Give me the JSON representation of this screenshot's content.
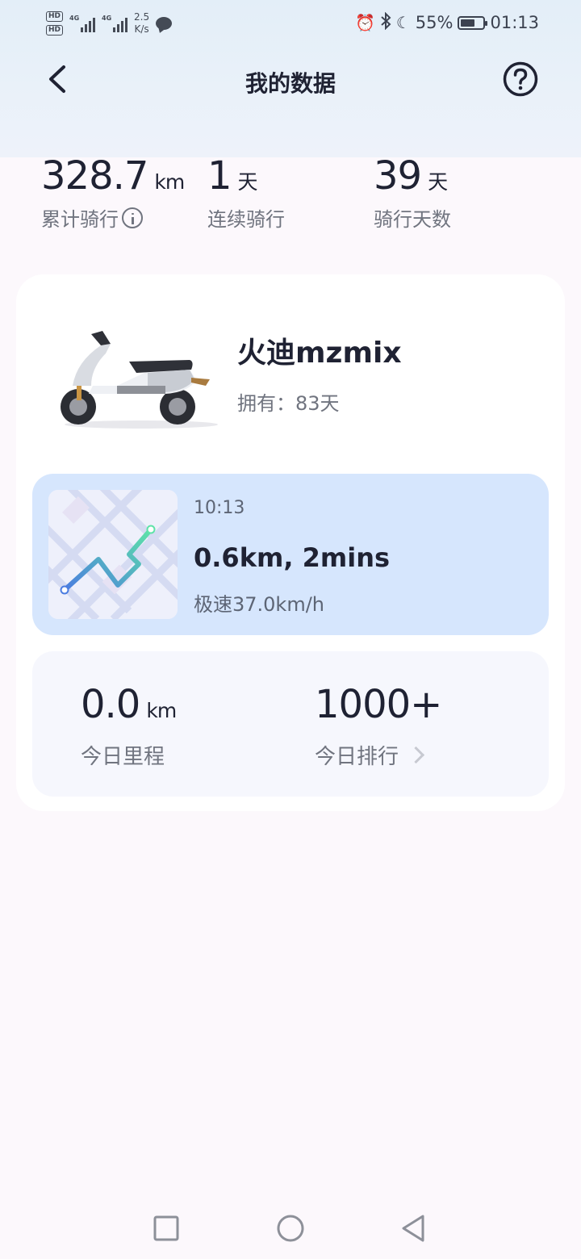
{
  "status_bar": {
    "network_speed_value": "2.5",
    "network_speed_unit": "K/s",
    "battery": "55%",
    "time": "01:13",
    "sim1": "HD",
    "sim2": "HD",
    "gen": "4G"
  },
  "header": {
    "title": "我的数据"
  },
  "stats": {
    "total_distance": {
      "value": "328.7",
      "unit": "km",
      "label": "累计骑行"
    },
    "streak": {
      "value": "1",
      "unit": "天",
      "label": "连续骑行"
    },
    "ride_days": {
      "value": "39",
      "unit": "天",
      "label": "骑行天数"
    }
  },
  "vehicle": {
    "name": "火迪mzmix",
    "owned_label": "拥有：",
    "owned_value": "83天"
  },
  "last_ride": {
    "time": "10:13",
    "summary": "0.6km, 2mins",
    "top_speed": "极速37.0km/h"
  },
  "today": {
    "distance": {
      "value": "0.0",
      "unit": "km",
      "label": "今日里程"
    },
    "rank": {
      "value": "1000+",
      "label": "今日排行"
    }
  },
  "icons": [
    "back-arrow-icon",
    "help-icon",
    "info-icon",
    "chevron-right-icon",
    "alarm-icon",
    "bluetooth-icon",
    "moon-icon",
    "battery-icon",
    "message-icon"
  ],
  "colors": {
    "ride_card": "#d6e6fd",
    "today_card": "#f6f7fd",
    "route_start": "#4a7ce0",
    "route_end": "#5ee3a8"
  }
}
